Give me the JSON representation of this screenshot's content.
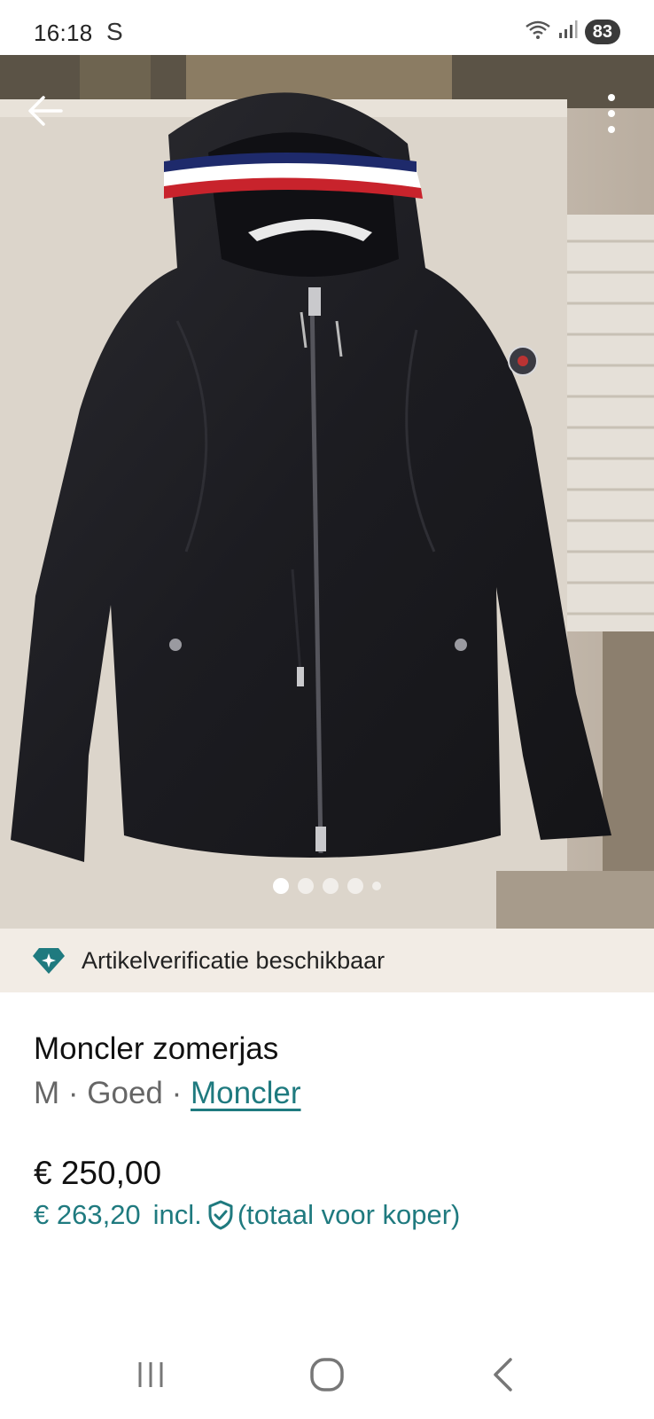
{
  "status_bar": {
    "time": "16:18",
    "carrier_icon": "S",
    "battery": "83"
  },
  "gallery": {
    "image_alt": "Moncler zomerjas photo",
    "current_index": 1,
    "total_images": 5
  },
  "verification": {
    "icon": "diamond-verify-icon",
    "label": "Artikelverificatie beschikbaar"
  },
  "product": {
    "title": "Moncler zomerjas",
    "size": "M",
    "separator": "·",
    "condition": "Goed",
    "brand": "Moncler",
    "price": "€ 250,00",
    "total_price": "€ 263,20",
    "incl_label": "incl.",
    "total_note": "(totaal voor koper)"
  },
  "colors": {
    "accent": "#1f7a7f",
    "banner_bg": "#f2ece5"
  }
}
